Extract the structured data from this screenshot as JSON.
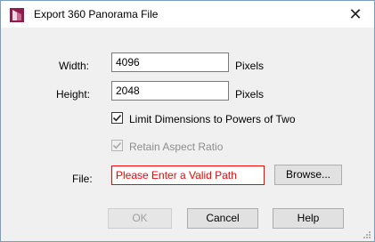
{
  "window": {
    "title": "Export 360 Panorama File",
    "close_glyph": "✕",
    "icon": "panorama-app-icon",
    "accent_color": "#8b1e4a"
  },
  "form": {
    "width_label": "Width:",
    "width_value": "4096",
    "width_unit": "Pixels",
    "height_label": "Height:",
    "height_value": "2048",
    "height_unit": "Pixels",
    "limit_powers_label": "Limit Dimensions to Powers of Two",
    "limit_powers_checked": true,
    "retain_aspect_label": "Retain Aspect Ratio",
    "retain_aspect_checked": true,
    "retain_aspect_disabled": true,
    "file_label": "File:",
    "file_value": "Please Enter a Valid Path",
    "file_error_color": "#ff0000",
    "browse_label": "Browse..."
  },
  "buttons": {
    "ok_label": "OK",
    "ok_disabled": true,
    "cancel_label": "Cancel",
    "help_label": "Help"
  }
}
